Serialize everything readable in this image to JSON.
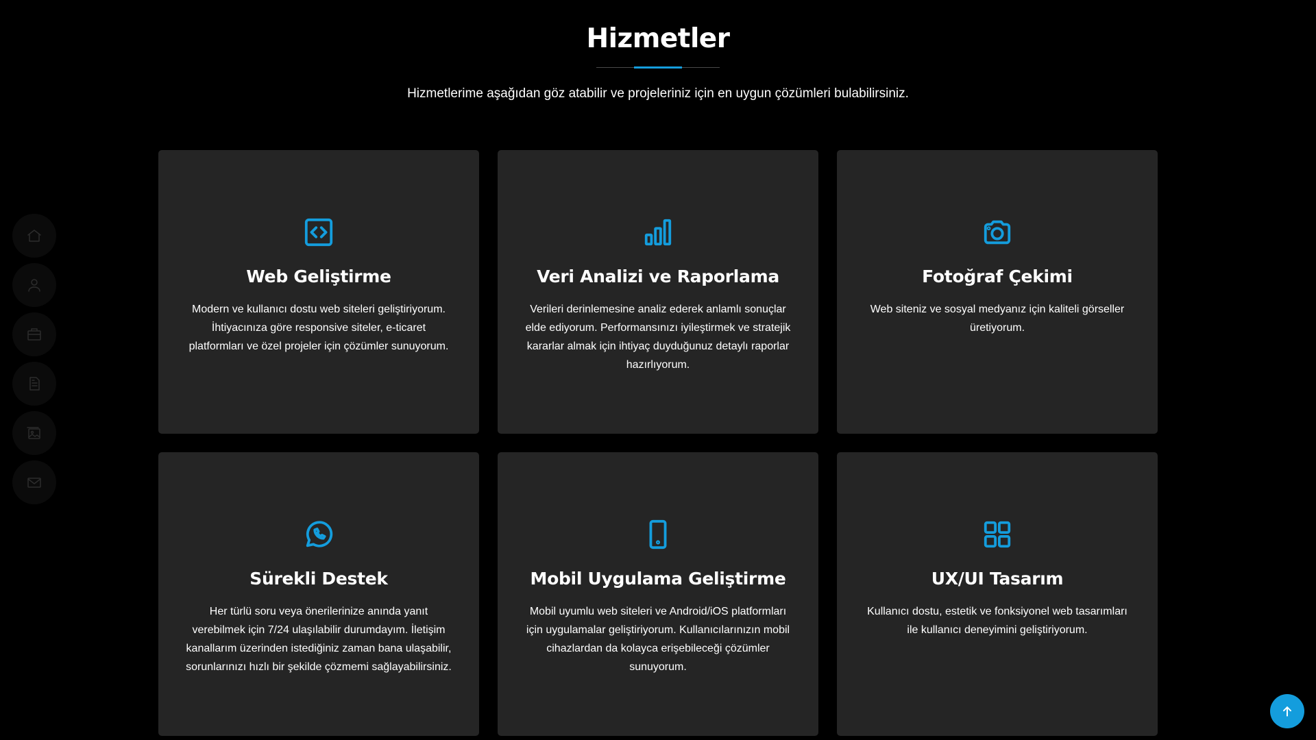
{
  "section": {
    "title": "Hizmetler",
    "subtitle": "Hizmetlerime aşağıdan göz atabilir ve projeleriniz için en uygun çözümleri bulabilirsiniz."
  },
  "sidebar": {
    "items": [
      {
        "icon": "home-icon"
      },
      {
        "icon": "person-icon"
      },
      {
        "icon": "briefcase-icon"
      },
      {
        "icon": "document-icon"
      },
      {
        "icon": "images-icon"
      },
      {
        "icon": "envelope-icon"
      }
    ]
  },
  "services": [
    {
      "icon": "code-icon",
      "title": "Web Geliştirme",
      "text": "Modern ve kullanıcı dostu web siteleri geliştiriyorum. İhtiyacınıza göre responsive siteler, e-ticaret platformları ve özel projeler için çözümler sunuyorum."
    },
    {
      "icon": "bar-chart-icon",
      "title": "Veri Analizi ve Raporlama",
      "text": "Verileri derinlemesine analiz ederek anlamlı sonuçlar elde ediyorum. Performansınızı iyileştirmek ve stratejik kararlar almak için ihtiyaç duyduğunuz detaylı raporlar hazırlıyorum."
    },
    {
      "icon": "camera-icon",
      "title": "Fotoğraf Çekimi",
      "text": "Web siteniz ve sosyal medyanız için kaliteli görseller üretiyorum."
    },
    {
      "icon": "whatsapp-icon",
      "title": "Sürekli Destek",
      "text": "Her türlü soru veya önerilerinize anında yanıt verebilmek için 7/24 ulaşılabilir durumdayım. İletişim kanallarım üzerinden istediğiniz zaman bana ulaşabilir, sorunlarınızı hızlı bir şekilde çözmemi sağlayabilirsiniz."
    },
    {
      "icon": "phone-icon",
      "title": "Mobil Uygulama Geliştirme",
      "text": "Mobil uyumlu web siteleri ve Android/iOS platformları için uygulamalar geliştiriyorum. Kullanıcılarınızın mobil cihazlardan da kolayca erişebileceği çözümler sunuyorum."
    },
    {
      "icon": "grid-icon",
      "title": "UX/UI Tasarım",
      "text": "Kullanıcı dostu, estetik ve fonksiyonel web tasarımları ile kullanıcı deneyimini geliştiriyorum."
    }
  ],
  "back_to_top": {
    "icon": "arrow-up-icon"
  },
  "colors": {
    "accent": "#149ddd",
    "background": "#000000",
    "card": "#252525"
  }
}
